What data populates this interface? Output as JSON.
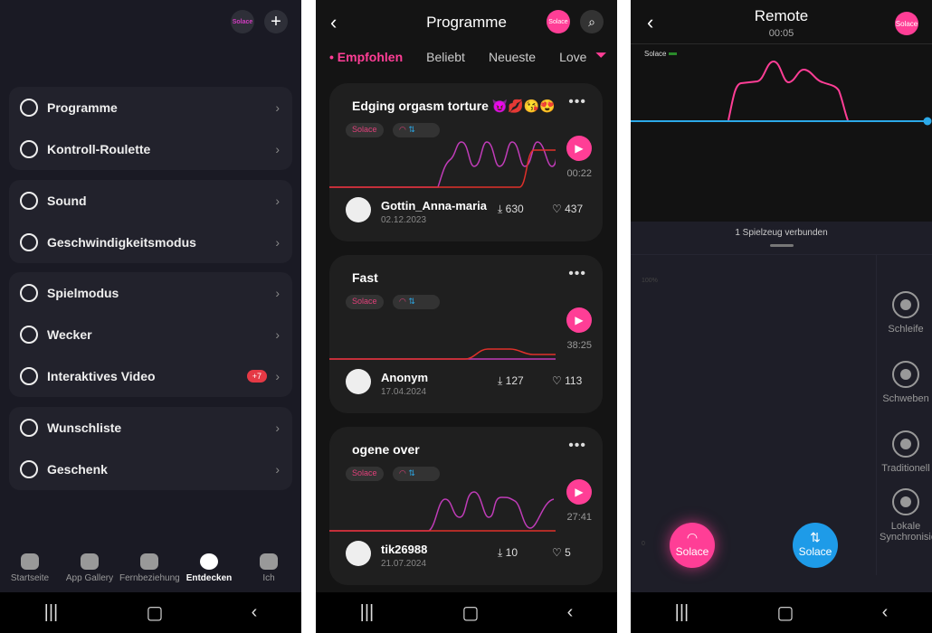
{
  "panel1": {
    "toy_chip": "Solace",
    "groups": [
      [
        {
          "label": "Programme",
          "icon": "wave-icon"
        },
        {
          "label": "Kontroll-Roulette",
          "icon": "roulette-icon"
        }
      ],
      [
        {
          "label": "Sound",
          "icon": "sound-icon"
        },
        {
          "label": "Geschwindigkeitsmodus",
          "icon": "speedometer-icon"
        }
      ],
      [
        {
          "label": "Spielmodus",
          "icon": "gamepad-icon"
        },
        {
          "label": "Wecker",
          "icon": "clock-icon"
        },
        {
          "label": "Interaktives Video",
          "icon": "play-circle-icon",
          "badge": "+7"
        }
      ],
      [
        {
          "label": "Wunschliste",
          "icon": "heart-icon"
        },
        {
          "label": "Geschenk",
          "icon": "gift-icon"
        }
      ]
    ],
    "bottom_nav": [
      {
        "label": "Startseite"
      },
      {
        "label": "App Gallery"
      },
      {
        "label": "Fernbeziehung"
      },
      {
        "label": "Entdecken",
        "active": true
      },
      {
        "label": "Ich"
      }
    ]
  },
  "panel2": {
    "title": "Programme",
    "toy_chip": "Solace",
    "tabs": [
      "Empfohlen",
      "Beliebt",
      "Neueste",
      "Love"
    ],
    "cards": [
      {
        "title": "Edging orgasm torture 😈💋😘😍",
        "tag": "Solace",
        "duration": "00:22",
        "user": "Gottin_Anna-maria",
        "date": "02.12.2023",
        "downloads": "630",
        "likes": "437"
      },
      {
        "title": "Fast",
        "tag": "Solace",
        "duration": "38:25",
        "user": "Anonym",
        "date": "17.04.2024",
        "downloads": "127",
        "likes": "113"
      },
      {
        "title": "ogene over",
        "tag": "Solace",
        "duration": "27:41",
        "user": "tik26988",
        "date": "21.07.2024",
        "downloads": "10",
        "likes": "5"
      }
    ]
  },
  "panel3": {
    "title": "Remote",
    "time": "00:05",
    "toy_chip": "Solace",
    "toy_label": "Solace",
    "connected": "1 Spielzeug verbunden",
    "axis_top": "100%",
    "axis_bottom": "0",
    "tools": [
      "Schleife",
      "Schweben",
      "Traditionell",
      "Lokale Synchronisierung"
    ],
    "btn_pink": "Solace",
    "btn_blue": "Solace",
    "colors": {
      "pink": "#ff3e96",
      "blue": "#1e9be8"
    }
  }
}
